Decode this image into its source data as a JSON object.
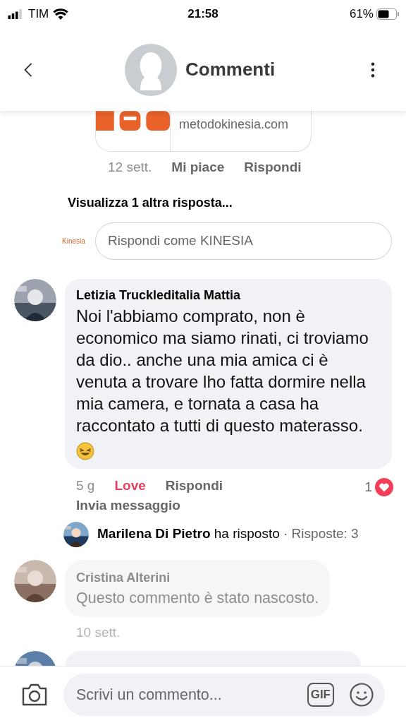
{
  "status_bar": {
    "carrier": "TIM",
    "time": "21:58",
    "battery": "61%"
  },
  "header": {
    "title": "Commenti"
  },
  "link_preview": {
    "domain": "metodokinesia.com"
  },
  "parent_actions": [
    {
      "label": "12 sett.",
      "kind": "time"
    },
    {
      "label": "Mi piace",
      "kind": "action"
    },
    {
      "label": "Rispondi",
      "kind": "action"
    }
  ],
  "more_replies": "Visualizza 1 altra risposta...",
  "reply_field": {
    "logo": "Kinesia",
    "placeholder": "Rispondi come KINESIA"
  },
  "comments": [
    {
      "author": "Letizia Truckleditalia Mattia",
      "text": "Noi l'abbiamo comprato, non è economico ma siamo rinati, ci troviamo da dio.. anche una mia amica ci è  venuta a trovare lho fatta dormire nella mia camera, e tornata a casa ha raccontato a tutti di questo materasso.",
      "hidden": false,
      "actions": [
        {
          "label": "5 g",
          "kind": "time"
        },
        {
          "label": "Love",
          "kind": "reaction"
        },
        {
          "label": "Rispondi",
          "kind": "action"
        }
      ],
      "extra_action": "Invia messaggio",
      "reaction_count": "1",
      "reply_summary": {
        "author": "Marilena Di Pietro",
        "verb": "ha risposto",
        "count": "· Risposte: 3"
      }
    },
    {
      "author": "Cristina Alterini",
      "text": "Questo commento è stato nascosto.",
      "hidden": true,
      "actions": [
        {
          "label": "10 sett.",
          "kind": "time"
        }
      ]
    }
  ],
  "composer": {
    "placeholder": "Scrivi un commento...",
    "gif": "GIF"
  }
}
